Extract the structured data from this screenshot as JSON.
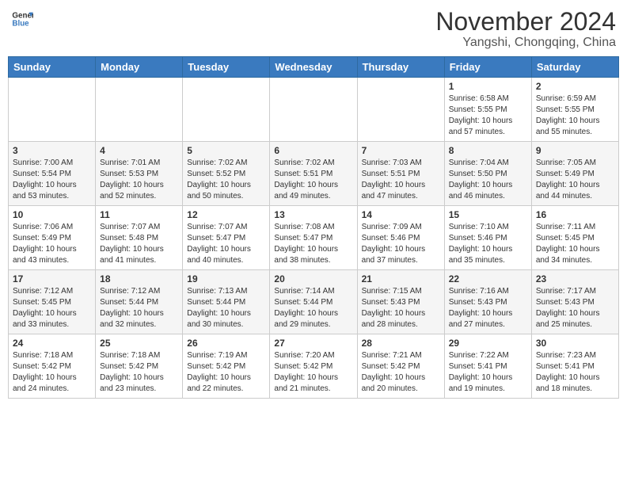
{
  "header": {
    "logo_general": "General",
    "logo_blue": "Blue",
    "month": "November 2024",
    "location": "Yangshi, Chongqing, China"
  },
  "weekdays": [
    "Sunday",
    "Monday",
    "Tuesday",
    "Wednesday",
    "Thursday",
    "Friday",
    "Saturday"
  ],
  "weeks": [
    [
      {
        "day": "",
        "info": ""
      },
      {
        "day": "",
        "info": ""
      },
      {
        "day": "",
        "info": ""
      },
      {
        "day": "",
        "info": ""
      },
      {
        "day": "",
        "info": ""
      },
      {
        "day": "1",
        "info": "Sunrise: 6:58 AM\nSunset: 5:55 PM\nDaylight: 10 hours and 57 minutes."
      },
      {
        "day": "2",
        "info": "Sunrise: 6:59 AM\nSunset: 5:55 PM\nDaylight: 10 hours and 55 minutes."
      }
    ],
    [
      {
        "day": "3",
        "info": "Sunrise: 7:00 AM\nSunset: 5:54 PM\nDaylight: 10 hours and 53 minutes."
      },
      {
        "day": "4",
        "info": "Sunrise: 7:01 AM\nSunset: 5:53 PM\nDaylight: 10 hours and 52 minutes."
      },
      {
        "day": "5",
        "info": "Sunrise: 7:02 AM\nSunset: 5:52 PM\nDaylight: 10 hours and 50 minutes."
      },
      {
        "day": "6",
        "info": "Sunrise: 7:02 AM\nSunset: 5:51 PM\nDaylight: 10 hours and 49 minutes."
      },
      {
        "day": "7",
        "info": "Sunrise: 7:03 AM\nSunset: 5:51 PM\nDaylight: 10 hours and 47 minutes."
      },
      {
        "day": "8",
        "info": "Sunrise: 7:04 AM\nSunset: 5:50 PM\nDaylight: 10 hours and 46 minutes."
      },
      {
        "day": "9",
        "info": "Sunrise: 7:05 AM\nSunset: 5:49 PM\nDaylight: 10 hours and 44 minutes."
      }
    ],
    [
      {
        "day": "10",
        "info": "Sunrise: 7:06 AM\nSunset: 5:49 PM\nDaylight: 10 hours and 43 minutes."
      },
      {
        "day": "11",
        "info": "Sunrise: 7:07 AM\nSunset: 5:48 PM\nDaylight: 10 hours and 41 minutes."
      },
      {
        "day": "12",
        "info": "Sunrise: 7:07 AM\nSunset: 5:47 PM\nDaylight: 10 hours and 40 minutes."
      },
      {
        "day": "13",
        "info": "Sunrise: 7:08 AM\nSunset: 5:47 PM\nDaylight: 10 hours and 38 minutes."
      },
      {
        "day": "14",
        "info": "Sunrise: 7:09 AM\nSunset: 5:46 PM\nDaylight: 10 hours and 37 minutes."
      },
      {
        "day": "15",
        "info": "Sunrise: 7:10 AM\nSunset: 5:46 PM\nDaylight: 10 hours and 35 minutes."
      },
      {
        "day": "16",
        "info": "Sunrise: 7:11 AM\nSunset: 5:45 PM\nDaylight: 10 hours and 34 minutes."
      }
    ],
    [
      {
        "day": "17",
        "info": "Sunrise: 7:12 AM\nSunset: 5:45 PM\nDaylight: 10 hours and 33 minutes."
      },
      {
        "day": "18",
        "info": "Sunrise: 7:12 AM\nSunset: 5:44 PM\nDaylight: 10 hours and 32 minutes."
      },
      {
        "day": "19",
        "info": "Sunrise: 7:13 AM\nSunset: 5:44 PM\nDaylight: 10 hours and 30 minutes."
      },
      {
        "day": "20",
        "info": "Sunrise: 7:14 AM\nSunset: 5:44 PM\nDaylight: 10 hours and 29 minutes."
      },
      {
        "day": "21",
        "info": "Sunrise: 7:15 AM\nSunset: 5:43 PM\nDaylight: 10 hours and 28 minutes."
      },
      {
        "day": "22",
        "info": "Sunrise: 7:16 AM\nSunset: 5:43 PM\nDaylight: 10 hours and 27 minutes."
      },
      {
        "day": "23",
        "info": "Sunrise: 7:17 AM\nSunset: 5:43 PM\nDaylight: 10 hours and 25 minutes."
      }
    ],
    [
      {
        "day": "24",
        "info": "Sunrise: 7:18 AM\nSunset: 5:42 PM\nDaylight: 10 hours and 24 minutes."
      },
      {
        "day": "25",
        "info": "Sunrise: 7:18 AM\nSunset: 5:42 PM\nDaylight: 10 hours and 23 minutes."
      },
      {
        "day": "26",
        "info": "Sunrise: 7:19 AM\nSunset: 5:42 PM\nDaylight: 10 hours and 22 minutes."
      },
      {
        "day": "27",
        "info": "Sunrise: 7:20 AM\nSunset: 5:42 PM\nDaylight: 10 hours and 21 minutes."
      },
      {
        "day": "28",
        "info": "Sunrise: 7:21 AM\nSunset: 5:42 PM\nDaylight: 10 hours and 20 minutes."
      },
      {
        "day": "29",
        "info": "Sunrise: 7:22 AM\nSunset: 5:41 PM\nDaylight: 10 hours and 19 minutes."
      },
      {
        "day": "30",
        "info": "Sunrise: 7:23 AM\nSunset: 5:41 PM\nDaylight: 10 hours and 18 minutes."
      }
    ]
  ]
}
